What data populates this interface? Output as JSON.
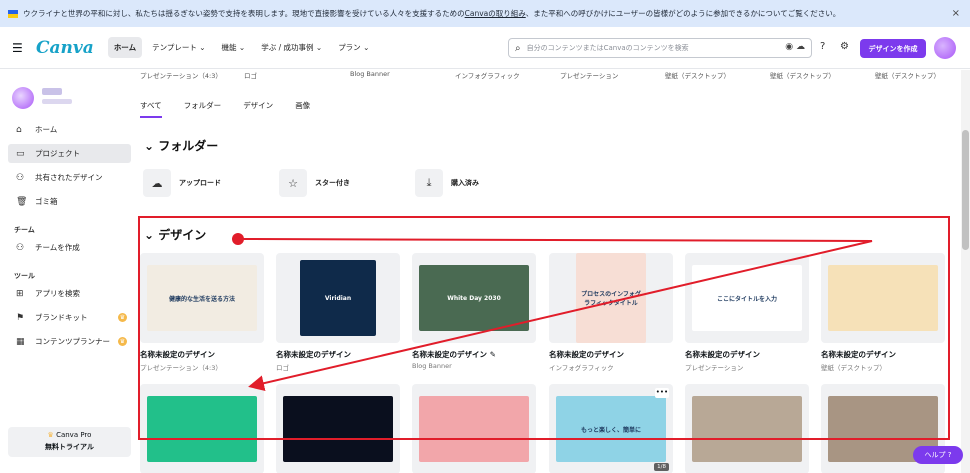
{
  "banner": {
    "text_before": "ウクライナと世界の平和に対し、私たちは揺るぎない姿勢で支持を表明します。現地で直接影響を受けている人々を支援するための",
    "link": "Canvaの取り組み",
    "text_after": "、また平和への呼びかけにユーザーの皆様がどのように参加できるかについてご覧ください。",
    "close": "×"
  },
  "header": {
    "logo": "Canva",
    "nav": [
      "ホーム",
      "テンプレート ⌄",
      "機能 ⌄",
      "学ぶ / 成功事例 ⌄",
      "プラン ⌄"
    ],
    "search_placeholder": "自分のコンテンツまたはCanvaのコンテンツを検索",
    "create_button": "デザインを作成"
  },
  "sidebar": {
    "items": [
      {
        "icon": "⌂",
        "label": "ホーム"
      },
      {
        "icon": "▭",
        "label": "プロジェクト"
      },
      {
        "icon": "⚇",
        "label": "共有されたデザイン"
      },
      {
        "icon": "🗑",
        "label": "ゴミ箱"
      }
    ],
    "team_section": "チーム",
    "team_items": [
      {
        "icon": "⚇",
        "label": "チームを作成"
      }
    ],
    "tools_section": "ツール",
    "tool_items": [
      {
        "icon": "⊞",
        "label": "アプリを検索"
      },
      {
        "icon": "⚑",
        "label": "ブランドキット"
      },
      {
        "icon": "▦",
        "label": "コンテンツプランナー"
      }
    ],
    "pro_line1": "Canva Pro",
    "pro_line2": "無料トライアル"
  },
  "top_labels": [
    "プレゼンテーション（4:3）",
    "ロゴ",
    "Blog Banner",
    "インフォグラフィック",
    "プレゼンテーション",
    "壁紙（デスクトップ）",
    "壁紙（デスクトップ）",
    "壁紙（デスクトップ）"
  ],
  "filters": [
    "すべて",
    "フォルダー",
    "デザイン",
    "画像"
  ],
  "folders_title": "フォルダー",
  "folders": [
    {
      "icon": "☁",
      "label": "アップロード"
    },
    {
      "icon": "☆",
      "label": "スター付き"
    },
    {
      "icon": "⤓",
      "label": "購入済み"
    }
  ],
  "designs_title": "デザイン",
  "designs_row1": [
    {
      "title": "名称未設定のデザイン",
      "sub": "プレゼンテーション（4:3）",
      "bg": "#f2ece2",
      "w": 110,
      "h": 66,
      "text": "健康的な生活を送る方法"
    },
    {
      "title": "名称未設定のデザイン",
      "sub": "ロゴ",
      "bg": "#0f2a4a",
      "w": 76,
      "h": 76,
      "text": "Viridian"
    },
    {
      "title": "名称未設定のデザイン ✎",
      "sub": "Blog Banner",
      "bg": "#4a6a52",
      "w": 110,
      "h": 66,
      "text": "White Day 2030"
    },
    {
      "title": "名称未設定のデザイン",
      "sub": "インフォグラフィック",
      "bg": "#f7ded5",
      "w": 70,
      "h": 90,
      "text": "プロセスのインフォグラフィックタイトル"
    },
    {
      "title": "名称未設定のデザイン",
      "sub": "プレゼンテーション",
      "bg": "#ffffff",
      "w": 110,
      "h": 66,
      "text": "ここにタイトルを入力"
    },
    {
      "title": "名称未設定のデザイン",
      "sub": "壁紙（デスクトップ）",
      "bg": "#f6e1b8",
      "w": 110,
      "h": 66,
      "text": ""
    }
  ],
  "designs_row2": [
    {
      "bg": "#22c08a",
      "w": 110,
      "h": 66
    },
    {
      "bg": "#0a0f1e",
      "w": 110,
      "h": 66
    },
    {
      "bg": "#f2a6aa",
      "w": 110,
      "h": 66
    },
    {
      "bg": "#8fd3e6",
      "w": 110,
      "h": 66,
      "text": "もっと楽しく、簡単に",
      "more": "•••",
      "pages": "1/8"
    },
    {
      "bg": "#b8a896",
      "w": 110,
      "h": 66
    },
    {
      "bg": "#a89583",
      "w": 110,
      "h": 66
    }
  ],
  "help_button": "ヘルプ ?",
  "colors": {
    "accent": "#7c3aed",
    "annotation": "#e11d2a"
  }
}
